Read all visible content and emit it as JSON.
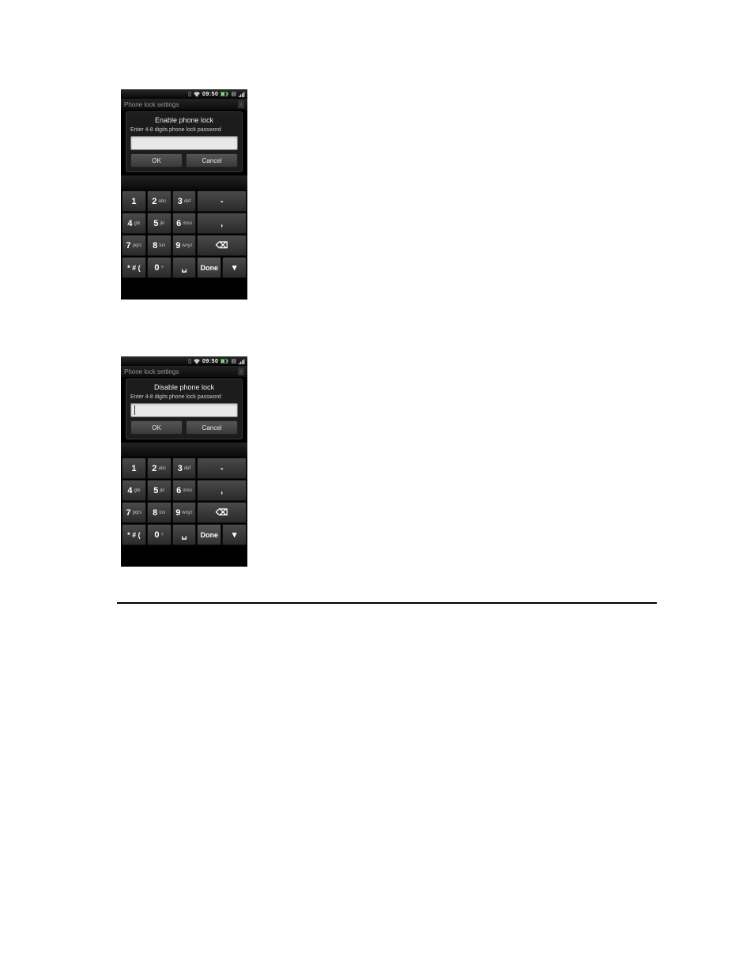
{
  "status": {
    "time": "09:50"
  },
  "header_title": "Phone lock settings",
  "screens": {
    "enable": {
      "dialog_title": "Enable phone lock",
      "prompt": "Enter 4-8 digits phone lock password",
      "ok": "OK",
      "cancel": "Cancel",
      "input_value": ""
    },
    "disable": {
      "dialog_title": "Disable phone lock",
      "prompt": "Enter 4-8 digits phone lock password",
      "ok": "OK",
      "cancel": "Cancel",
      "input_value": ""
    }
  },
  "keypad": {
    "k1": {
      "n": "1",
      "l": ""
    },
    "k2": {
      "n": "2",
      "l": "abc"
    },
    "k3": {
      "n": "3",
      "l": "def"
    },
    "kminus": {
      "n": "-",
      "l": ""
    },
    "k4": {
      "n": "4",
      "l": "ghi"
    },
    "k5": {
      "n": "5",
      "l": "jkl"
    },
    "k6": {
      "n": "6",
      "l": "mno"
    },
    "kcomma": {
      "n": ",",
      "l": ""
    },
    "k7": {
      "n": "7",
      "l": "pqrs"
    },
    "k8": {
      "n": "8",
      "l": "tuv"
    },
    "k9": {
      "n": "9",
      "l": "wxyz"
    },
    "kdel": {
      "n": "⌫",
      "l": "DEL"
    },
    "ksym": {
      "n": "* # (",
      "l": ""
    },
    "k0": {
      "n": "0",
      "l": "+"
    },
    "kspace": {
      "n": "␣",
      "l": ""
    },
    "kdone": {
      "n": "Done",
      "l": ""
    },
    "khide": {
      "n": "▾",
      "l": ""
    }
  }
}
